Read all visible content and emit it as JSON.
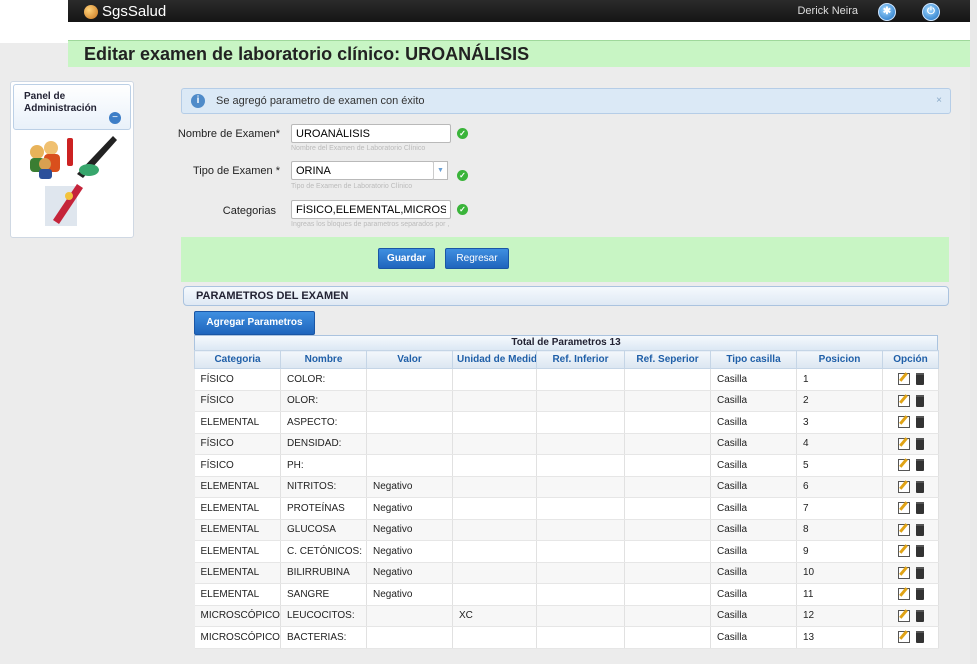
{
  "app": {
    "name": "SgsSalud",
    "user": "Derick Neira"
  },
  "page": {
    "title": "Editar examen de laboratorio clínico: UROANÁLISIS"
  },
  "sidebar": {
    "title": "Panel de Administración",
    "toggle": "−"
  },
  "alert": {
    "icon": "i",
    "message": "Se agregó parametro de examen con éxito",
    "close": "×"
  },
  "form": {
    "name_label": "Nombre de Examen*",
    "name_value": "UROANÁLISIS",
    "name_hint": "Nombre del Examen de Laboratorio Clínico",
    "type_label": "Tipo de Examen *",
    "type_value": "ORINA",
    "type_hint": "Tipo de Examen de Laboratorio Clínico",
    "categories_label": "Categorias",
    "categories_value": "FÍSICO,ELEMENTAL,MICROSCÓPICO",
    "categories_hint": "Ingreas los bloques de parametros separados por ,"
  },
  "buttons": {
    "save": "Guardar",
    "back": "Regresar",
    "add_params": "Agregar Parametros"
  },
  "section": {
    "title": "PARAMETROS DEL EXAMEN"
  },
  "grid": {
    "caption": "Total de Parametros 13",
    "columns": [
      "Categoria",
      "Nombre",
      "Valor",
      "Unidad de Medida",
      "Ref. Inferior",
      "Ref. Seperior",
      "Tipo casilla",
      "Posicion",
      "Opción"
    ],
    "rows": [
      [
        "FÍSICO",
        "COLOR:",
        "",
        "",
        "",
        "",
        "Casilla",
        "1"
      ],
      [
        "FÍSICO",
        "OLOR:",
        "",
        "",
        "",
        "",
        "Casilla",
        "2"
      ],
      [
        "ELEMENTAL",
        "ASPECTO:",
        "",
        "",
        "",
        "",
        "Casilla",
        "3"
      ],
      [
        "FÍSICO",
        "DENSIDAD:",
        "",
        "",
        "",
        "",
        "Casilla",
        "4"
      ],
      [
        "FÍSICO",
        "PH:",
        "",
        "",
        "",
        "",
        "Casilla",
        "5"
      ],
      [
        "ELEMENTAL",
        "NITRITOS:",
        "Negativo",
        "",
        "",
        "",
        "Casilla",
        "6"
      ],
      [
        "ELEMENTAL",
        "PROTEÍNAS",
        "Negativo",
        "",
        "",
        "",
        "Casilla",
        "7"
      ],
      [
        "ELEMENTAL",
        "GLUCOSA",
        "Negativo",
        "",
        "",
        "",
        "Casilla",
        "8"
      ],
      [
        "ELEMENTAL",
        "C. CETÓNICOS:",
        "Negativo",
        "",
        "",
        "",
        "Casilla",
        "9"
      ],
      [
        "ELEMENTAL",
        "BILIRRUBINA",
        "Negativo",
        "",
        "",
        "",
        "Casilla",
        "10"
      ],
      [
        "ELEMENTAL",
        "SANGRE",
        "Negativo",
        "",
        "",
        "",
        "Casilla",
        "11"
      ],
      [
        "MICROSCÓPICO",
        "LEUCOCITOS:",
        "",
        "XC",
        "",
        "",
        "Casilla",
        "12"
      ],
      [
        "MICROSCÓPICO",
        "BACTERIAS:",
        "",
        "",
        "",
        "",
        "Casilla",
        "13"
      ]
    ]
  },
  "icons": {
    "logo": "logo-icon",
    "edit": "edit-icon",
    "delete": "trash-icon",
    "ok": "check-icon"
  }
}
